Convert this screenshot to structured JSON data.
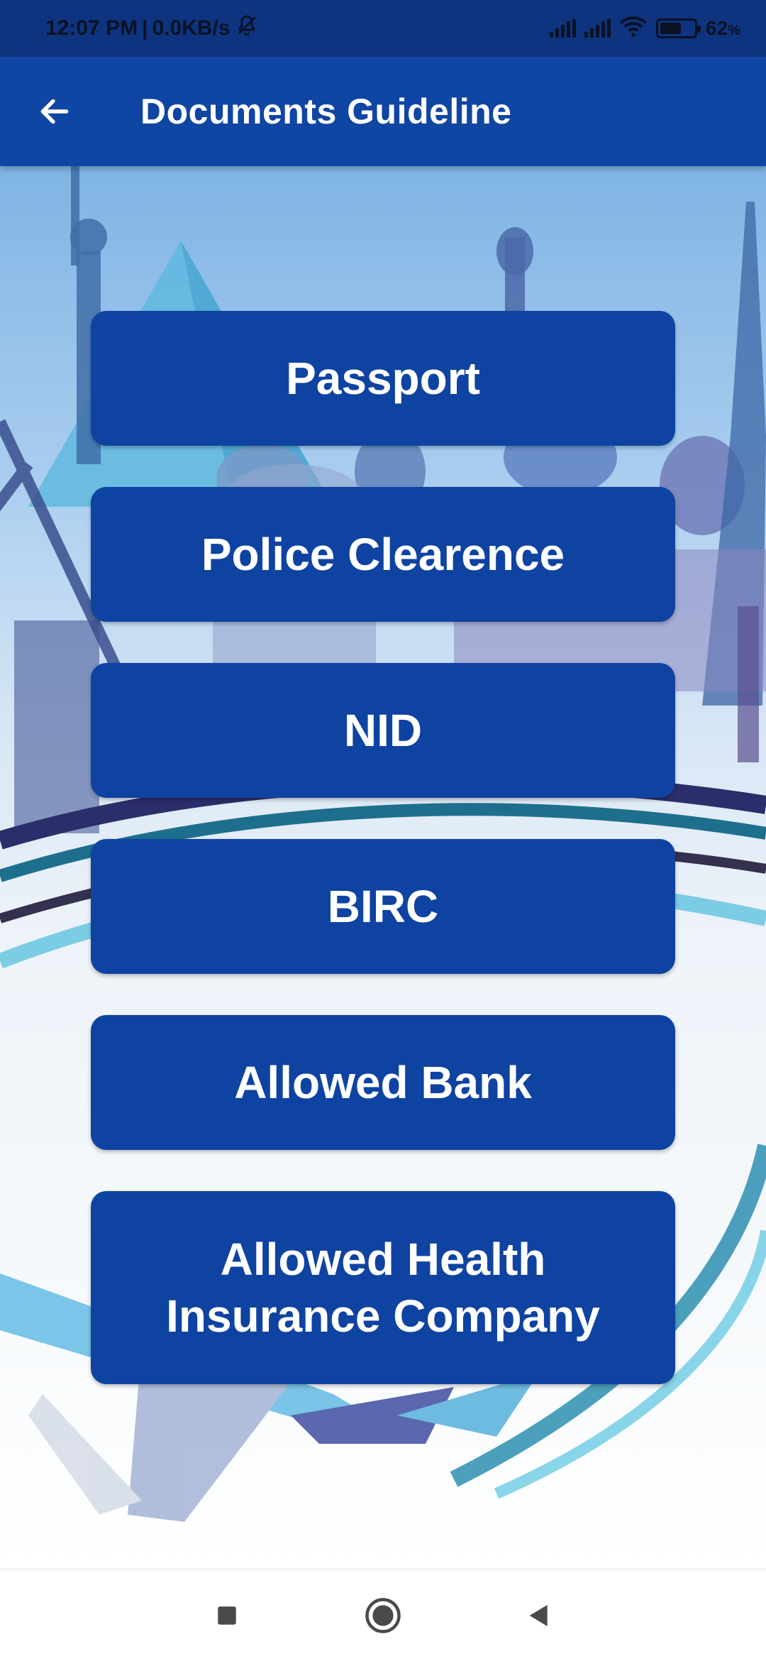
{
  "status_bar": {
    "time": "12:07 PM",
    "separator": "|",
    "net_speed": "0.0KB/s",
    "battery_text": "62",
    "battery_unit": "%",
    "battery_level": 0.62,
    "icons": [
      "mute-notification-icon",
      "signal-icon",
      "signal-icon",
      "wifi-icon",
      "battery-icon"
    ]
  },
  "app_bar": {
    "title": "Documents Guideline",
    "back_icon": "back-arrow-icon"
  },
  "documents": [
    {
      "label": "Passport"
    },
    {
      "label": "Police Clearence"
    },
    {
      "label": "NID"
    },
    {
      "label": "BIRC"
    },
    {
      "label": "Allowed Bank"
    },
    {
      "label": "Allowed Health Insurance Company"
    }
  ],
  "nav_bar": {
    "icons": [
      "recents-square-icon",
      "home-circle-icon",
      "back-triangle-icon"
    ]
  },
  "colors": {
    "app_bar": "#0f45a3",
    "status_bar": "#0e347f",
    "button": "#0e43a1",
    "button_text": "#ffffff"
  }
}
